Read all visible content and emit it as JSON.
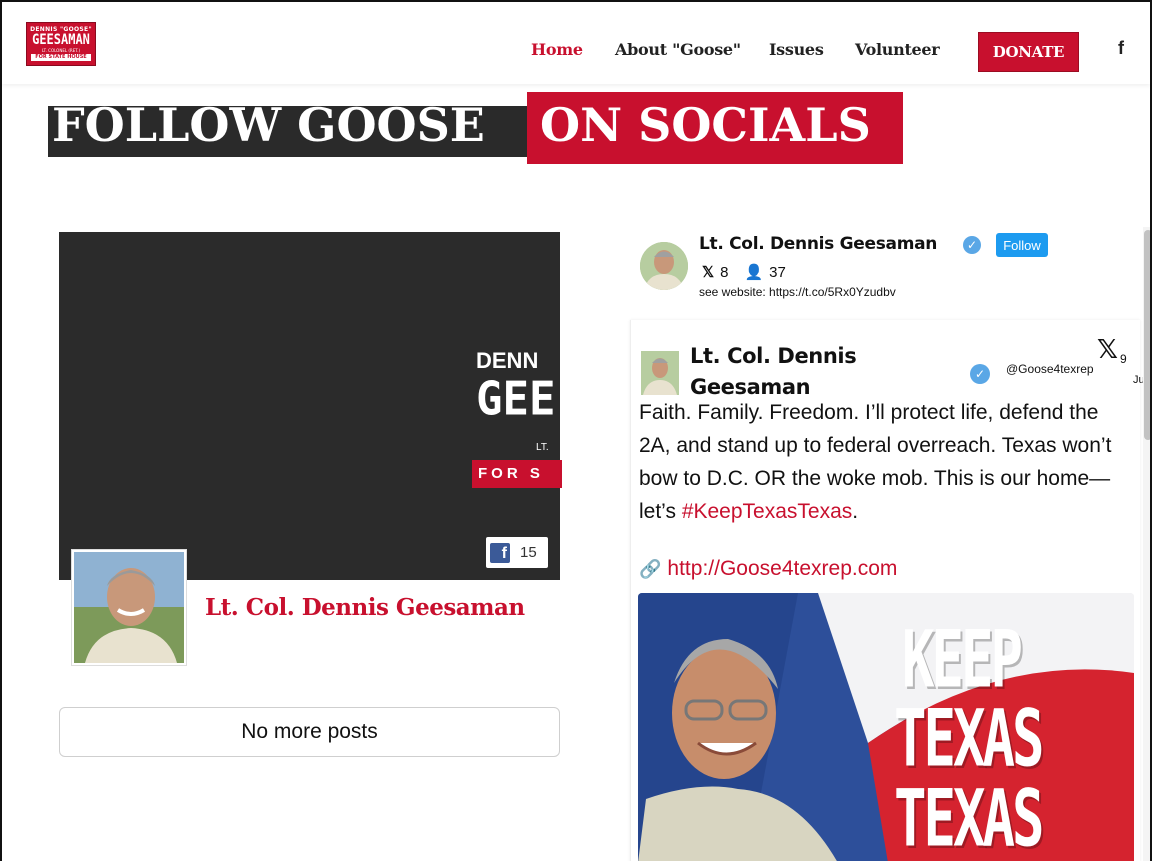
{
  "header": {
    "logo": {
      "line1": "DENNIS \"GOOSE\"",
      "line2": "GEESAMAN",
      "line3": "LT. COLONEL (RET.)",
      "line4": "FOR STATE HOUSE"
    },
    "nav": [
      {
        "label": "Home",
        "active": true
      },
      {
        "label": "About \"Goose\""
      },
      {
        "label": "Issues"
      },
      {
        "label": "Volunteer"
      }
    ],
    "donate_label": "DONATE",
    "facebook_icon": "f"
  },
  "banner": {
    "part1": "FOLLOW GOOSE",
    "part2": "ON SOCIALS"
  },
  "facebook": {
    "cover": {
      "line1": "DENN",
      "line2": "GEE",
      "line3": "LT.",
      "line4": "FOR S"
    },
    "like_count": "15",
    "page_name": "Lt. Col. Dennis Geesaman",
    "no_more_posts": "No more posts"
  },
  "x_widget": {
    "profile_name": "Lt. Col. Dennis Geesaman",
    "follow_label": "Follow",
    "posts_count": "8",
    "followers_count": "37",
    "website_text": "see website: https://t.co/5Rx0Yzudbv",
    "post": {
      "author": "Lt. Col. Dennis Geesaman",
      "handle": "@Goose4texrep",
      "date_day": "9",
      "date_month": "Jun",
      "text": "Faith. Family. Freedom. I’ll protect life, defend the 2A, and stand up to federal overreach. Texas won’t bow to D.C. OR the woke mob. This is our home—let’s ",
      "hashtag": "#KeepTexasTexas",
      "text_end": ".",
      "link": "http://Goose4texrep.com",
      "image_text": {
        "line1": "KEEP",
        "line2": "TEXAS",
        "line3": "TEXAS"
      }
    }
  },
  "colors": {
    "brand_red": "#c8102e",
    "dark": "#2a2a2a",
    "x_blue": "#1d9bf0",
    "facebook_blue": "#3b5a98"
  }
}
